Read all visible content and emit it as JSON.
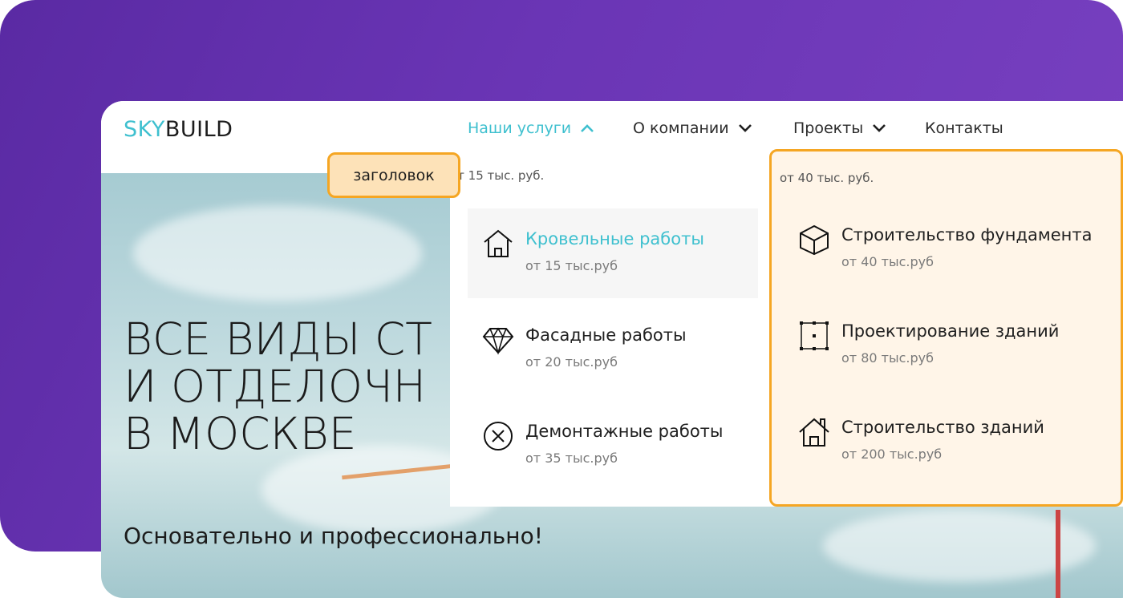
{
  "brand": {
    "logo_part1": "SKY",
    "logo_part2": "BUILD",
    "accent": "#3fc0cf"
  },
  "nav": {
    "items": [
      {
        "label": "Наши услуги",
        "icon": "chevron-up-icon"
      },
      {
        "label": "О компании",
        "icon": "chevron-down-icon"
      },
      {
        "label": "Проекты",
        "icon": "chevron-down-icon"
      },
      {
        "label": "Контакты"
      }
    ]
  },
  "hero": {
    "title_line1": "ВСЕ ВИДЫ СТ",
    "title_line2": "И ОТДЕЛОЧН",
    "title_line3": "В МОСКВЕ",
    "subtitle": "Основательно и профессионально!"
  },
  "menu": {
    "left_price": "от 15 тыс. руб.",
    "right_price": "от 40 тыс. руб.",
    "left_items": [
      {
        "title": "Кровельные работы",
        "price": "от 15 тыс.руб",
        "icon": "house-icon"
      },
      {
        "title": "Фасадные работы",
        "price": "от 20 тыс.руб",
        "icon": "diamond-icon"
      },
      {
        "title": "Демонтажные работы",
        "price": "от 35 тыс.руб",
        "icon": "close-circle-icon"
      }
    ],
    "right_items": [
      {
        "title": "Строительство фундамента",
        "price": "от 40 тыс.руб",
        "icon": "cube-icon"
      },
      {
        "title": "Проектирование зданий",
        "price": "от 80 тыс.руб",
        "icon": "blueprint-icon"
      },
      {
        "title": "Строительство зданий",
        "price": "от 200 тыс.руб",
        "icon": "building-house-icon"
      }
    ]
  },
  "annotation": {
    "label": "заголовок",
    "color": "#f5a623"
  }
}
